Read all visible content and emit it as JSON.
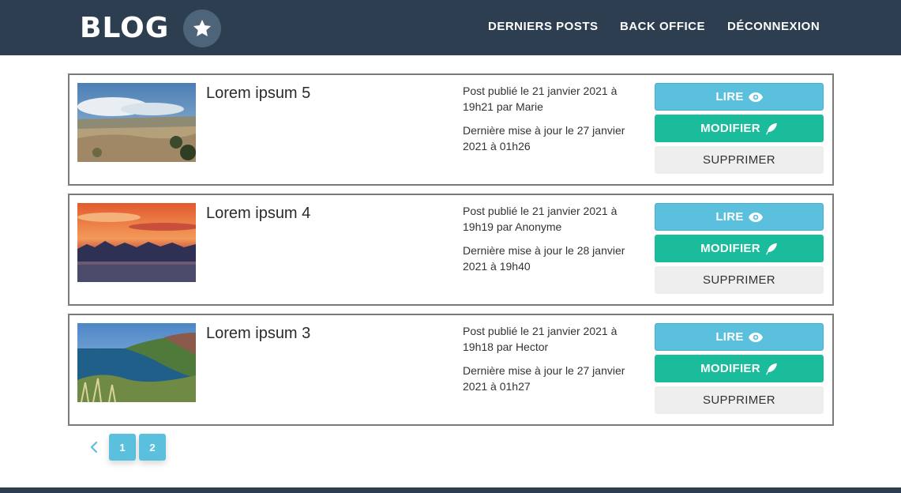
{
  "navbar": {
    "brand": "BLOG",
    "links": [
      "DERNIERS POSTS",
      "BACK OFFICE",
      "DÉCONNEXION"
    ]
  },
  "posts": [
    {
      "title": "Lorem ipsum 5",
      "published": "Post publié le 21 janvier 2021 à 19h21 par Marie",
      "updated": "Dernière mise à jour le 27 janvier 2021 à 01h26",
      "read_label": "LIRE",
      "edit_label": "MODIFIER",
      "delete_label": "SUPPRIMER"
    },
    {
      "title": "Lorem ipsum 4",
      "published": "Post publié le 21 janvier 2021 à 19h19 par Anonyme",
      "updated": "Dernière mise à jour le 28 janvier 2021 à 19h40",
      "read_label": "LIRE",
      "edit_label": "MODIFIER",
      "delete_label": "SUPPRIMER"
    },
    {
      "title": "Lorem ipsum 3",
      "published": "Post publié le 21 janvier 2021 à 19h18 par Hector",
      "updated": "Dernière mise à jour le 27 janvier 2021 à 01h27",
      "read_label": "LIRE",
      "edit_label": "MODIFIER",
      "delete_label": "SUPPRIMER"
    }
  ],
  "pagination": {
    "pages": [
      "1",
      "2"
    ]
  },
  "colors": {
    "navbar": "#2c3e50",
    "read_button": "#5bc0de",
    "edit_button": "#1abc9c",
    "delete_button": "#eeeeee"
  },
  "icons": {
    "brand": "star-icon",
    "read": "eye-icon",
    "edit": "feather-icon",
    "prev": "chevron-left-icon"
  }
}
